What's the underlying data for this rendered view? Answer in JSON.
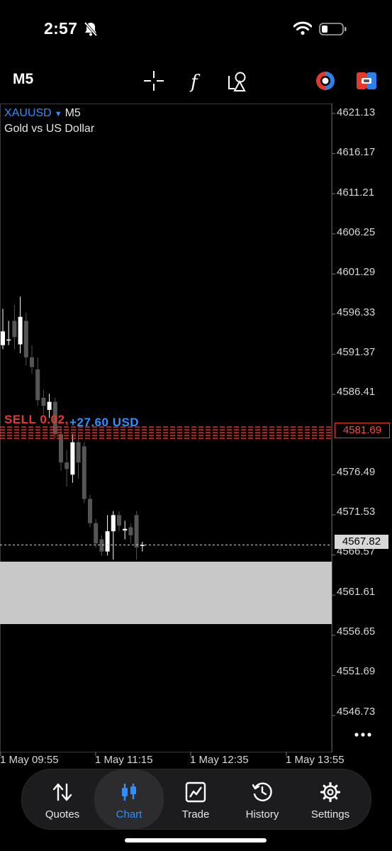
{
  "status_bar": {
    "time": "2:57",
    "icons": [
      "bell-slash-icon",
      "wifi-icon",
      "battery-icon"
    ]
  },
  "toolbar": {
    "timeframe": "M5",
    "icons": [
      "crosshair-icon",
      "indicators-icon",
      "objects-icon",
      "one-click-trading-icon",
      "trade-mode-icon"
    ]
  },
  "chart": {
    "symbol": "XAUUSD",
    "symbol_arrow": "▼",
    "timeframe": "M5",
    "description": "Gold vs US Dollar",
    "price_ticks": [
      "4621.13",
      "4616.17",
      "4611.21",
      "4606.25",
      "4601.29",
      "4596.33",
      "4591.37",
      "4586.41",
      "4576.49",
      "4571.53",
      "4566.57",
      "4561.61",
      "4556.65",
      "4551.69",
      "4546.73"
    ],
    "time_ticks": [
      "1 May 09:55",
      "1 May 11:15",
      "1 May 12:35",
      "1 May 13:55"
    ],
    "order_line": {
      "label": "SELL 0.02, ",
      "profit": "+27.60 USD",
      "price": "4581.69"
    },
    "current_price": "4567.82",
    "colors": {
      "background": "#000000",
      "bull": "#ffffff",
      "bear": "#555555",
      "sell_line": "#e83a2c",
      "profit": "#2f8fff"
    }
  },
  "chart_data": {
    "type": "candlestick",
    "symbol": "XAUUSD",
    "ylim": [
      4543.0,
      4623.0
    ],
    "candles": [
      {
        "o": 4592.5,
        "h": 4597.0,
        "l": 4592.0,
        "c": 4594.2
      },
      {
        "o": 4593.2,
        "h": 4595.5,
        "l": 4592.5,
        "c": 4593.2
      },
      {
        "o": 4595.5,
        "h": 4597.5,
        "l": 4592.0,
        "c": 4593.5
      },
      {
        "o": 4592.6,
        "h": 4598.5,
        "l": 4591.5,
        "c": 4596.0
      },
      {
        "o": 4595.5,
        "h": 4596.5,
        "l": 4590.0,
        "c": 4591.0
      },
      {
        "o": 4591.0,
        "h": 4592.5,
        "l": 4589.0,
        "c": 4589.8
      },
      {
        "o": 4589.5,
        "h": 4591.0,
        "l": 4585.0,
        "c": 4585.7
      },
      {
        "o": 4586.0,
        "h": 4587.0,
        "l": 4584.0,
        "c": 4585.0
      },
      {
        "o": 4584.5,
        "h": 4586.5,
        "l": 4583.5,
        "c": 4585.5
      },
      {
        "o": 4585.5,
        "h": 4586.0,
        "l": 4581.0,
        "c": 4581.5
      },
      {
        "o": 4581.5,
        "h": 4582.5,
        "l": 4577.0,
        "c": 4578.0
      },
      {
        "o": 4578.0,
        "h": 4579.5,
        "l": 4575.0,
        "c": 4577.2
      },
      {
        "o": 4576.5,
        "h": 4581.5,
        "l": 4575.5,
        "c": 4580.5
      },
      {
        "o": 4580.5,
        "h": 4581.5,
        "l": 4576.0,
        "c": 4578.0
      },
      {
        "o": 4580.0,
        "h": 4580.5,
        "l": 4573.0,
        "c": 4573.5
      },
      {
        "o": 4573.5,
        "h": 4574.0,
        "l": 4570.0,
        "c": 4570.5
      },
      {
        "o": 4570.5,
        "h": 4571.0,
        "l": 4567.5,
        "c": 4568.0
      },
      {
        "o": 4568.5,
        "h": 4569.0,
        "l": 4566.5,
        "c": 4567.0
      },
      {
        "o": 4567.0,
        "h": 4571.5,
        "l": 4566.5,
        "c": 4569.5
      },
      {
        "o": 4569.5,
        "h": 4572.0,
        "l": 4566.0,
        "c": 4571.5
      },
      {
        "o": 4571.5,
        "h": 4572.0,
        "l": 4569.5,
        "c": 4570.2
      },
      {
        "o": 4569.6,
        "h": 4570.8,
        "l": 4568.5,
        "c": 4569.8
      },
      {
        "o": 4570.0,
        "h": 4570.5,
        "l": 4568.0,
        "c": 4569.0
      },
      {
        "o": 4571.5,
        "h": 4572.0,
        "l": 4566.0,
        "c": 4567.5
      },
      {
        "o": 4567.8,
        "h": 4568.2,
        "l": 4567.0,
        "c": 4567.82
      }
    ],
    "order_price": 4581.69,
    "current_price": 4567.82,
    "grid": false
  },
  "bottom_nav": {
    "items": [
      {
        "label": "Quotes",
        "icon": "quotes-icon",
        "active": false
      },
      {
        "label": "Chart",
        "icon": "chart-icon",
        "active": true
      },
      {
        "label": "Trade",
        "icon": "trade-icon",
        "active": false
      },
      {
        "label": "History",
        "icon": "history-icon",
        "active": false
      },
      {
        "label": "Settings",
        "icon": "settings-icon",
        "active": false
      }
    ]
  }
}
